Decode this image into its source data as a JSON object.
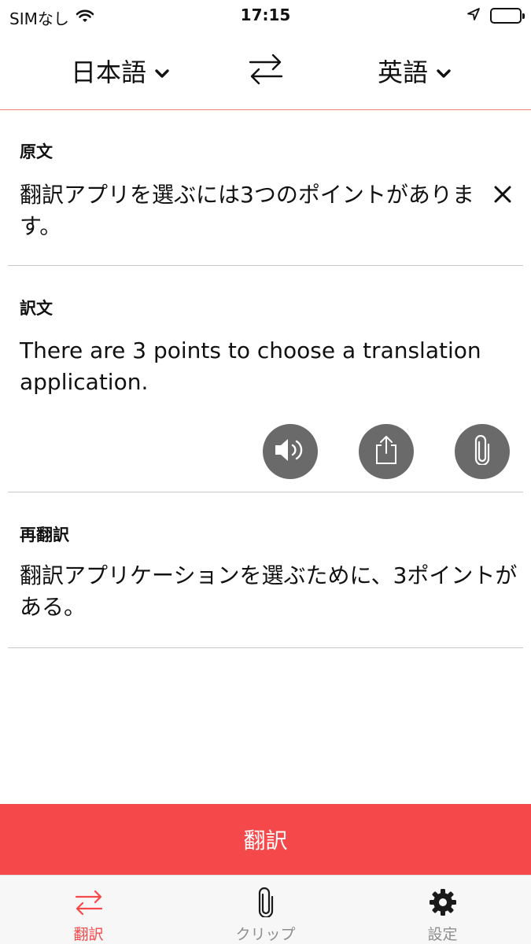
{
  "status_bar": {
    "carrier": "SIMなし",
    "time": "17:15"
  },
  "languages": {
    "source": "日本語",
    "target": "英語"
  },
  "source": {
    "title": "原文",
    "text": "翻訳アプリを選ぶには3つのポイントがあります。"
  },
  "translation": {
    "title": "訳文",
    "text": "There are 3 points to choose a translation application."
  },
  "retranslation": {
    "title": "再翻訳",
    "text": "翻訳アプリケーションを選ぶために、3ポイントがある。"
  },
  "translate_button": {
    "label": "翻訳"
  },
  "tabs": [
    {
      "label": "翻訳",
      "icon": "swap-arrows-icon",
      "active": true
    },
    {
      "label": "クリップ",
      "icon": "paperclip-icon",
      "active": false
    },
    {
      "label": "設定",
      "icon": "gear-icon",
      "active": false
    }
  ],
  "colors": {
    "accent": "#f5484a",
    "button_gray": "#6a6a6a",
    "inactive_tab": "#8e8e8e",
    "header_divider": "#ee8080"
  }
}
